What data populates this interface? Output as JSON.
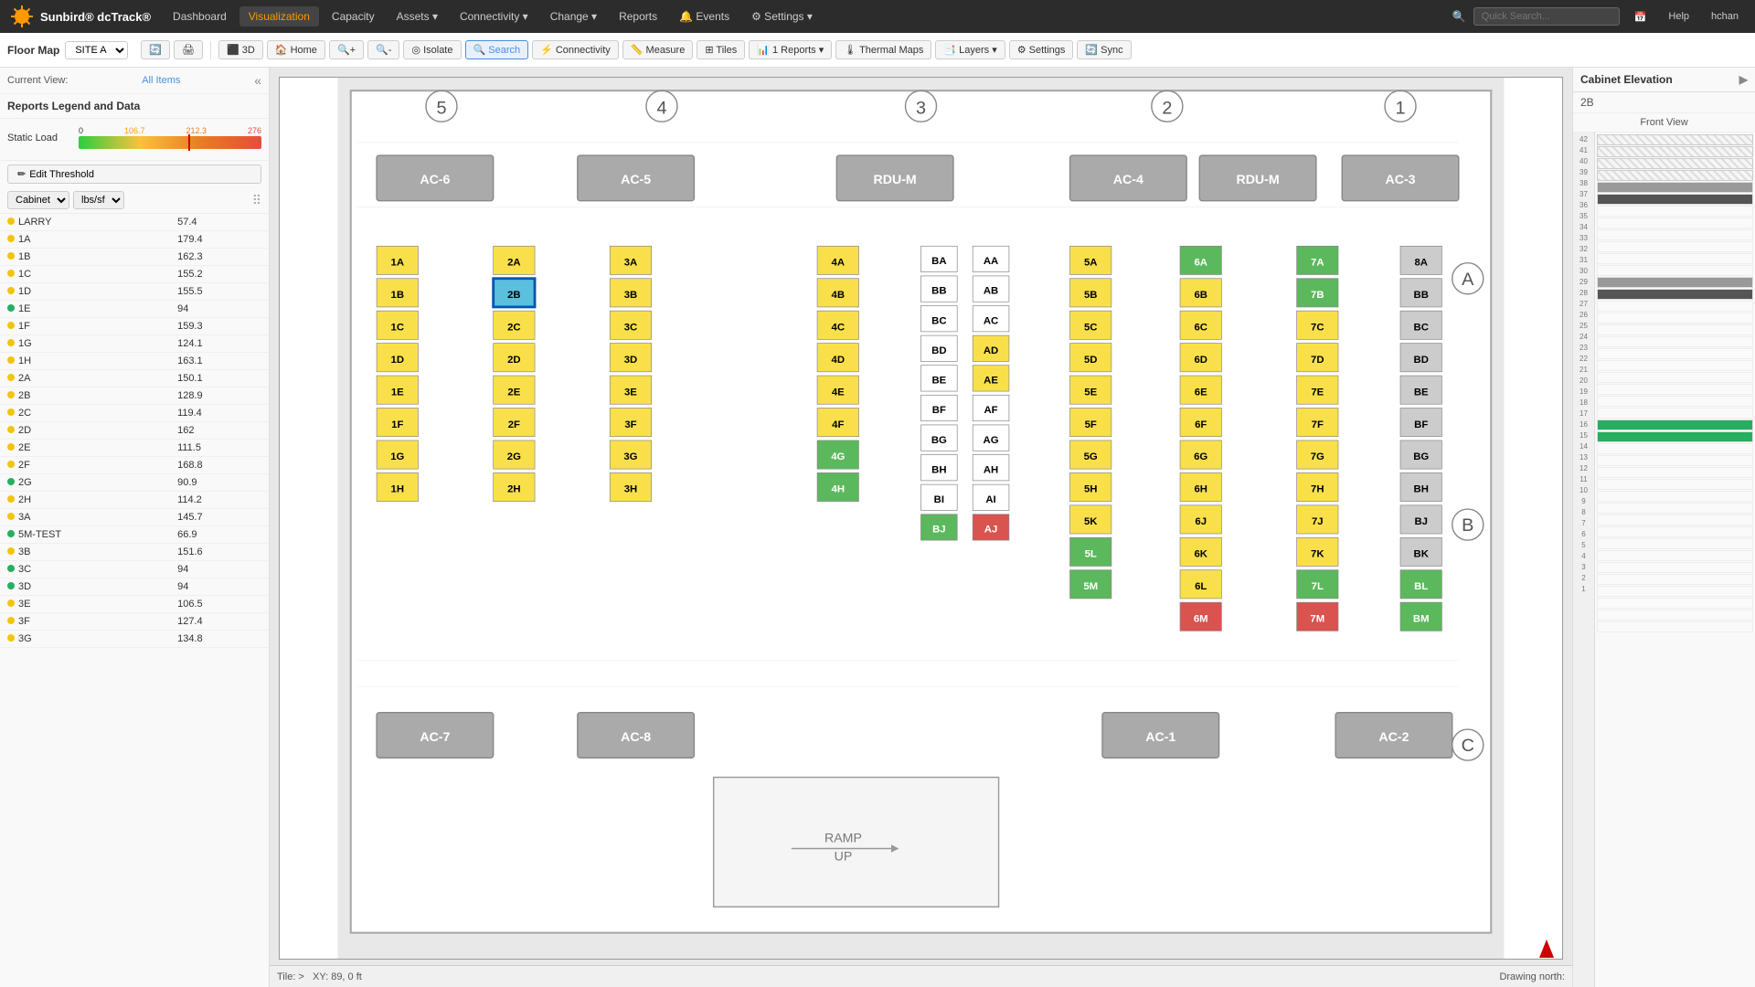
{
  "app": {
    "logo": "☀",
    "brand": "dcTrack®",
    "product": "Sunbird"
  },
  "topnav": {
    "items": [
      {
        "label": "Dashboard",
        "active": false
      },
      {
        "label": "Visualization",
        "active": true
      },
      {
        "label": "Capacity",
        "active": false
      },
      {
        "label": "Assets",
        "active": false,
        "hasDropdown": true
      },
      {
        "label": "Connectivity",
        "active": false,
        "hasDropdown": true
      },
      {
        "label": "Change",
        "active": false,
        "hasDropdown": true
      },
      {
        "label": "Reports",
        "active": false
      },
      {
        "label": "Events",
        "active": false
      },
      {
        "label": "Settings",
        "active": false,
        "hasDropdown": true
      }
    ],
    "search_placeholder": "Quick Search...",
    "help_label": "Help",
    "user_label": "hchan"
  },
  "toolbar": {
    "floor_map_label": "Floor Map",
    "site_value": "SITE A",
    "buttons": [
      {
        "label": "3D",
        "icon": "⬛"
      },
      {
        "label": "Home",
        "icon": "🏠"
      },
      {
        "label": "zoom_in",
        "icon": "+"
      },
      {
        "label": "zoom_out",
        "icon": "-"
      },
      {
        "label": "Isolate",
        "icon": "◎"
      },
      {
        "label": "Search",
        "icon": "🔍",
        "active": true
      },
      {
        "label": "Connectivity",
        "icon": "⚡"
      },
      {
        "label": "Measure",
        "icon": "📏"
      },
      {
        "label": "Tiles",
        "icon": "⊞"
      },
      {
        "label": "1 Reports",
        "icon": "📊",
        "hasDropdown": true
      },
      {
        "label": "Thermal Maps",
        "icon": "🌡"
      },
      {
        "label": "Layers",
        "icon": "📑",
        "hasDropdown": true
      },
      {
        "label": "Settings",
        "icon": "⚙"
      },
      {
        "label": "Sync",
        "icon": "🔄"
      }
    ]
  },
  "leftpanel": {
    "current_view_label": "Current View:",
    "current_view_value": "All Items",
    "legend_title": "Reports Legend and Data",
    "legend": {
      "name": "Static Load",
      "markers": [
        "0",
        "106.7",
        "212.3",
        "276"
      ],
      "marker_colors": [
        "#333",
        "#f90",
        "#e67e22",
        "#e74c3c"
      ]
    },
    "edit_threshold_label": "Edit Threshold",
    "table_col1": "Cabinet",
    "table_col2": "lbs/sf",
    "rows": [
      {
        "name": "LARRY",
        "dot": "yellow",
        "value": "57.4"
      },
      {
        "name": "1A",
        "dot": "yellow",
        "value": "179.4"
      },
      {
        "name": "1B",
        "dot": "yellow",
        "value": "162.3"
      },
      {
        "name": "1C",
        "dot": "yellow",
        "value": "155.2"
      },
      {
        "name": "1D",
        "dot": "yellow",
        "value": "155.5"
      },
      {
        "name": "1E",
        "dot": "green",
        "value": "94"
      },
      {
        "name": "1F",
        "dot": "yellow",
        "value": "159.3"
      },
      {
        "name": "1G",
        "dot": "yellow",
        "value": "124.1"
      },
      {
        "name": "1H",
        "dot": "yellow",
        "value": "163.1"
      },
      {
        "name": "2A",
        "dot": "yellow",
        "value": "150.1"
      },
      {
        "name": "2B",
        "dot": "yellow",
        "value": "128.9"
      },
      {
        "name": "2C",
        "dot": "yellow",
        "value": "119.4"
      },
      {
        "name": "2D",
        "dot": "yellow",
        "value": "162"
      },
      {
        "name": "2E",
        "dot": "yellow",
        "value": "111.5"
      },
      {
        "name": "2F",
        "dot": "yellow",
        "value": "168.8"
      },
      {
        "name": "2G",
        "dot": "green",
        "value": "90.9"
      },
      {
        "name": "2H",
        "dot": "yellow",
        "value": "114.2"
      },
      {
        "name": "3A",
        "dot": "yellow",
        "value": "145.7"
      },
      {
        "name": "5M-TEST",
        "dot": "green",
        "value": "66.9"
      },
      {
        "name": "3B",
        "dot": "yellow",
        "value": "151.6"
      },
      {
        "name": "3C",
        "dot": "green",
        "value": "94"
      },
      {
        "name": "3D",
        "dot": "green",
        "value": "94"
      },
      {
        "name": "3E",
        "dot": "yellow",
        "value": "106.5"
      },
      {
        "name": "3F",
        "dot": "yellow",
        "value": "127.4"
      },
      {
        "name": "3G",
        "dot": "yellow",
        "value": "134.8"
      }
    ]
  },
  "map": {
    "tile_label": "Tile:",
    "coordinates": "XY: 89, 0 ft",
    "drawing_north": "Drawing north:",
    "row_labels": [
      "A",
      "B",
      "C"
    ],
    "col_labels": [
      "5",
      "4",
      "3",
      "2",
      "1"
    ],
    "cabinets": {
      "row1": [
        "1A",
        "1B",
        "1C",
        "1D",
        "1E",
        "1F",
        "1G",
        "1H"
      ],
      "row2": [
        "2A",
        "2B",
        "2C",
        "2D",
        "2E",
        "2F",
        "2G",
        "2H"
      ],
      "selected": "2B"
    }
  },
  "right_panel": {
    "title": "Cabinet Elevation",
    "cabinet_id": "2B",
    "view_label": "Front View",
    "units": [
      42,
      41,
      40,
      39,
      38,
      37,
      36,
      35,
      34,
      33,
      32,
      31,
      30,
      29,
      28,
      27,
      26,
      25,
      24,
      23,
      22,
      21,
      20,
      19,
      18,
      17,
      16,
      15,
      14,
      13,
      12,
      11,
      10,
      9,
      8,
      7,
      6,
      5,
      4,
      3,
      2,
      1
    ]
  }
}
